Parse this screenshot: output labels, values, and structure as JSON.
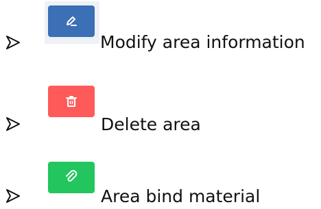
{
  "colors": {
    "edit_button": "#3b6fb6",
    "delete_button": "#ff5a5a",
    "bind_button": "#22c55e",
    "icon": "#ffffff",
    "text": "#111111"
  },
  "items": [
    {
      "icon": "pencil-icon",
      "label": "Modify area information"
    },
    {
      "icon": "trash-icon",
      "label": "Delete area"
    },
    {
      "icon": "paperclip-icon",
      "label": "Area bind material"
    }
  ]
}
